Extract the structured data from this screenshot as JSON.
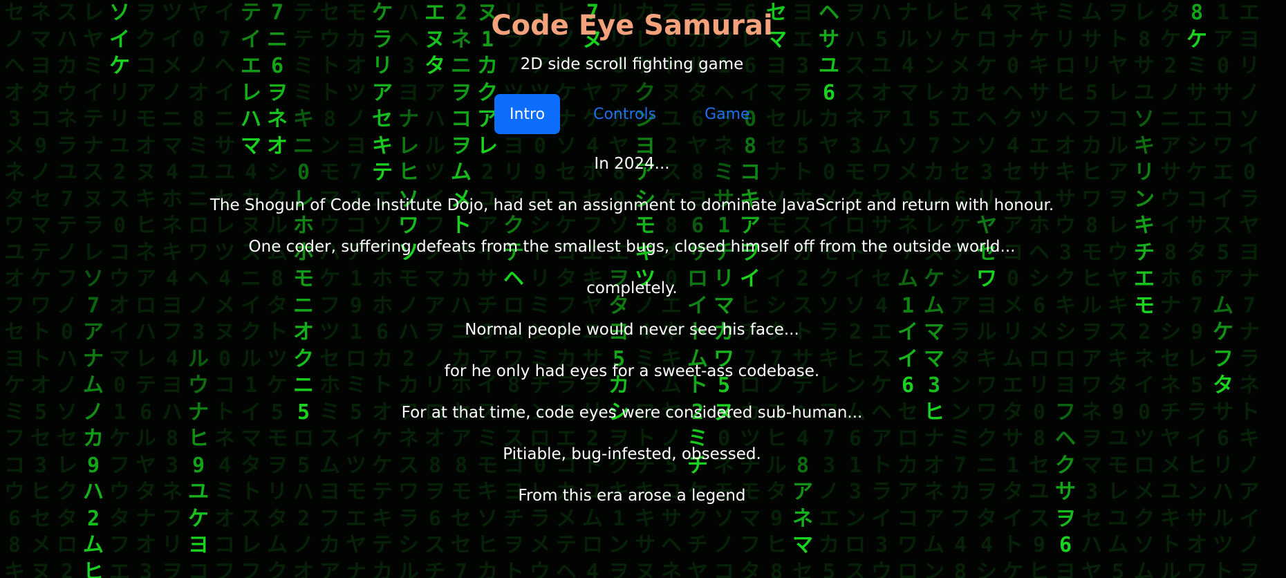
{
  "app": {
    "title": "Code Eye Samurai",
    "subtitle": "2D side scroll fighting game"
  },
  "tabs": [
    {
      "label": "Intro",
      "active": true
    },
    {
      "label": "Controls",
      "active": false
    },
    {
      "label": "Game",
      "active": false
    }
  ],
  "story": {
    "lines": [
      "In 2024...",
      "The Shogun of Code Institute Dojo, had set an assignment to dominate JavaScript and return with honour.",
      "One coder, suffering defeats from the smallest bugs, closed himself off from the outside world...",
      "completely.",
      "Normal people would never see his face...",
      "for he only had eyes for a sweet-ass codebase.",
      "For at that time, code eyes were considered sub-human...",
      "Pitiable, bug-infested, obsessed.",
      "From this era arose a legend"
    ]
  },
  "theme": {
    "title_color": "#f4a27c",
    "accent_color": "#0d6efd",
    "link_color": "#1f6ff0",
    "matrix_bright": "#19d31f",
    "matrix_dim": "#0b3a0c",
    "background": "#020402"
  },
  "matrix_glyphs": "アイウエオカキクケコサシスセソタチツテトナニヌネノハヒフヘホマミムメモヤユヨラリルレロワヲン0123456789"
}
